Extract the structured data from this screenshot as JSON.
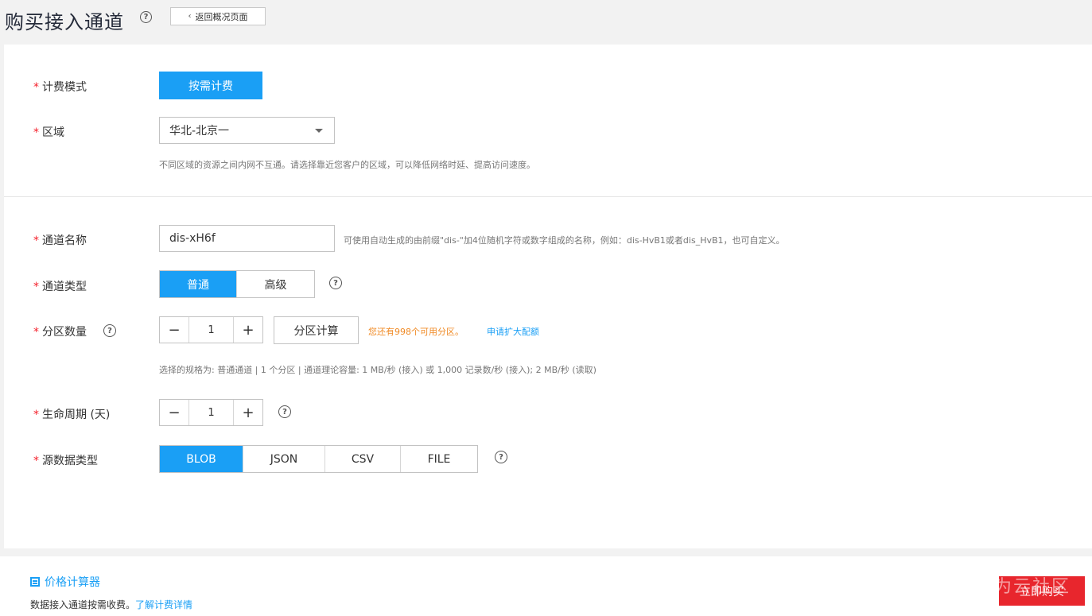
{
  "header": {
    "title": "购买接入通道",
    "back_label": "返回概况页面"
  },
  "billing": {
    "label": "计费模式",
    "button": "按需计费"
  },
  "region": {
    "label": "区域",
    "value": "华北-北京一",
    "hint": "不同区域的资源之间内网不互通。请选择靠近您客户的区域，可以降低网络时延、提高访问速度。"
  },
  "channel_name": {
    "label": "通道名称",
    "value": "dis-xH6f",
    "hint": "可使用自动生成的由前缀\"dis-\"加4位随机字符或数字组成的名称，例如：dis-HvB1或者dis_HvB1，也可自定义。"
  },
  "channel_type": {
    "label": "通道类型",
    "options": [
      "普通",
      "高级"
    ],
    "selected": "普通"
  },
  "partitions": {
    "label": "分区数量",
    "value": "1",
    "calc_button": "分区计算",
    "quota_text": "您还有998个可用分区。",
    "quota_link": "申请扩大配额",
    "spec_hint": "选择的规格为: 普通通道 | 1 个分区 | 通道理论容量: 1 MB/秒 (接入) 或 1,000 记录数/秒 (接入); 2 MB/秒 (读取)"
  },
  "lifecycle": {
    "label": "生命周期 (天)",
    "value": "1"
  },
  "source_type": {
    "label": "源数据类型",
    "options": [
      "BLOB",
      "JSON",
      "CSV",
      "FILE"
    ],
    "selected": "BLOB"
  },
  "footer": {
    "calculator": "价格计算器",
    "note": "数据接入通道按需收费。",
    "note_link": "了解计费详情",
    "buy_button": "立即购买",
    "watermark": "为云社区"
  },
  "icons": {
    "help": "?",
    "minus": "−",
    "plus": "+",
    "back_chevron": "‹"
  },
  "colors": {
    "primary": "#1a9ff5",
    "required": "#f5222d",
    "warning": "#f08a24",
    "buy": "#e8262d"
  }
}
